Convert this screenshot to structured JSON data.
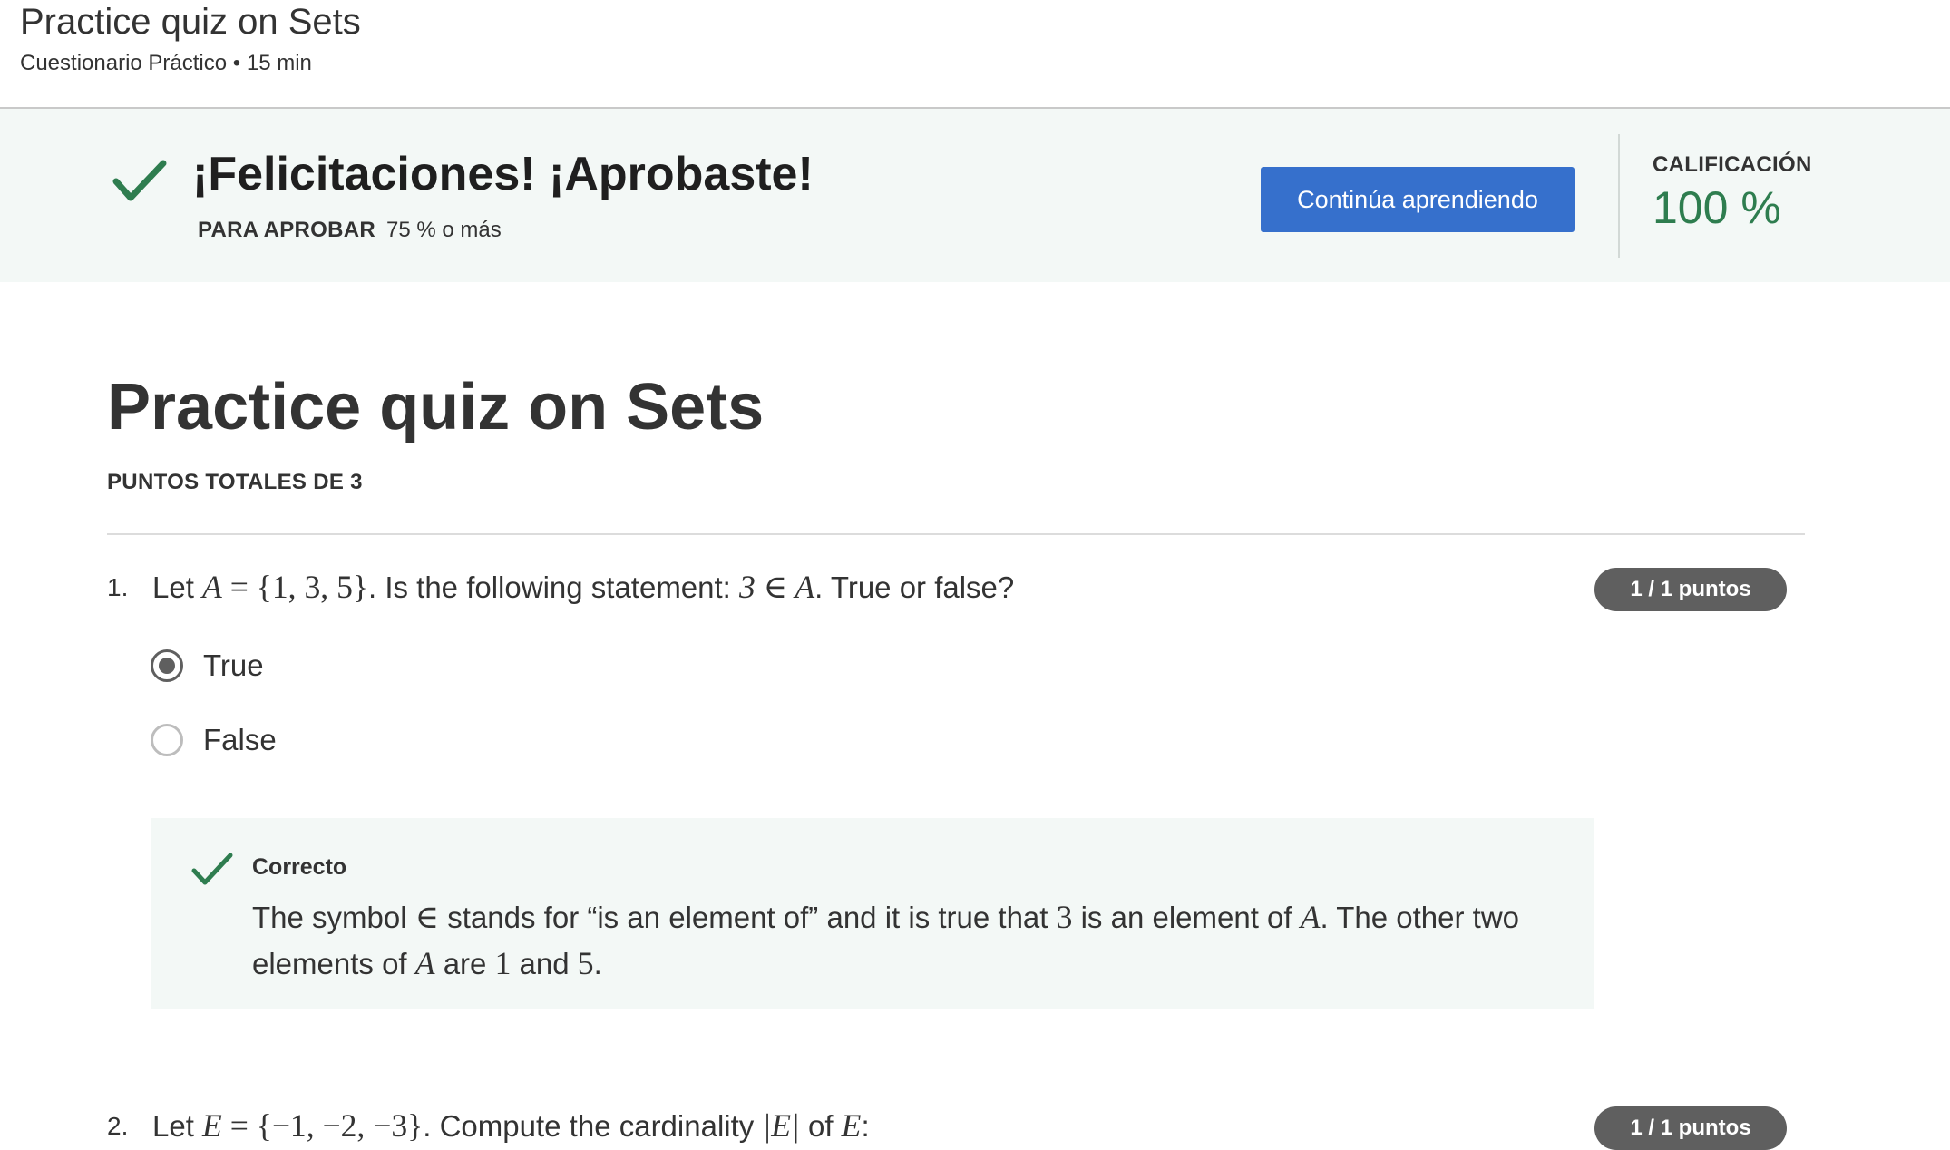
{
  "header": {
    "title": "Practice quiz on Sets",
    "subtitle": "Cuestionario Práctico • 15 min"
  },
  "result": {
    "message": "¡Felicitaciones! ¡Aprobaste!",
    "pass_label": "PARA APROBAR",
    "pass_value": "75 % o más",
    "continue_label": "Continúa aprendiendo",
    "grade_label": "CALIFICACIÓN",
    "grade_value": "100 %",
    "icon": "check-icon",
    "accent_color": "#2e7d4f",
    "button_color": "#3670cc"
  },
  "quiz": {
    "title": "Practice quiz on Sets",
    "total_points": "PUNTOS TOTALES DE 3",
    "questions": [
      {
        "number": "1.",
        "text_parts": [
          "Let ",
          "A",
          " = {1, 3, 5}",
          ". Is the following statement: ",
          "3 ∈ A",
          ". True or false?"
        ],
        "points": "1 / 1 puntos",
        "options": [
          {
            "label": "True",
            "selected": true
          },
          {
            "label": "False",
            "selected": false
          }
        ],
        "feedback": {
          "title": "Correcto",
          "text_parts": [
            "The symbol ",
            "∈",
            " stands for “is an element of” and it is true that ",
            "3",
            " is an element of ",
            "A",
            ". The other two elements of ",
            "A",
            " are ",
            "1",
            " and ",
            "5",
            "."
          ]
        }
      },
      {
        "number": "2.",
        "text_parts": [
          "Let ",
          "E",
          " = {−1, −2, −3}",
          ". Compute the cardinality ",
          "|E|",
          " of ",
          "E",
          ":"
        ],
        "points": "1 / 1 puntos"
      }
    ]
  }
}
